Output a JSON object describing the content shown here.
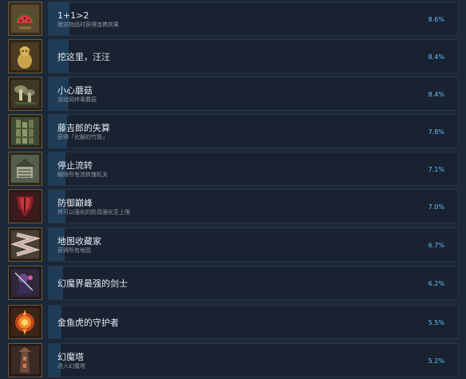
{
  "achievements": [
    {
      "title": "1+1>2",
      "desc": "赠送物品时获得连携效果",
      "percent": "8.6%",
      "icon": "watermelon-slices-icon",
      "fill": 0.086
    },
    {
      "title": "挖这里，汪汪",
      "desc": "",
      "percent": "8.4%",
      "icon": "golden-dog-icon",
      "fill": 0.084
    },
    {
      "title": "小心蘑菇",
      "desc": "送给同伴毒蘑菇",
      "percent": "8.4%",
      "icon": "mushroom-icon",
      "fill": 0.084
    },
    {
      "title": "藤吉郎的失算",
      "desc": "获得「化解的竹筒」",
      "percent": "7.8%",
      "icon": "bamboo-tube-icon",
      "fill": 0.078
    },
    {
      "title": "停止流转",
      "desc": "解除所有流转傀机关",
      "percent": "7.1%",
      "icon": "house-mechanism-icon",
      "fill": 0.071
    },
    {
      "title": "防御巅峰",
      "desc": "将可以强化的防具强化至上限",
      "percent": "7.0%",
      "icon": "armor-icon",
      "fill": 0.07
    },
    {
      "title": "地图收藏家",
      "desc": "获得所有地图",
      "percent": "6.7%",
      "icon": "map-scroll-icon",
      "fill": 0.067
    },
    {
      "title": "幻魔界最强的剑士",
      "desc": "",
      "percent": "6.2%",
      "icon": "demon-swordsman-icon",
      "fill": 0.062
    },
    {
      "title": "金鱼虎的守护者",
      "desc": "",
      "percent": "5.5%",
      "icon": "fire-emblem-icon",
      "fill": 0.055
    },
    {
      "title": "幻魔塔",
      "desc": "进入幻魔塔",
      "percent": "5.2%",
      "icon": "demon-tower-icon",
      "fill": 0.052
    }
  ]
}
